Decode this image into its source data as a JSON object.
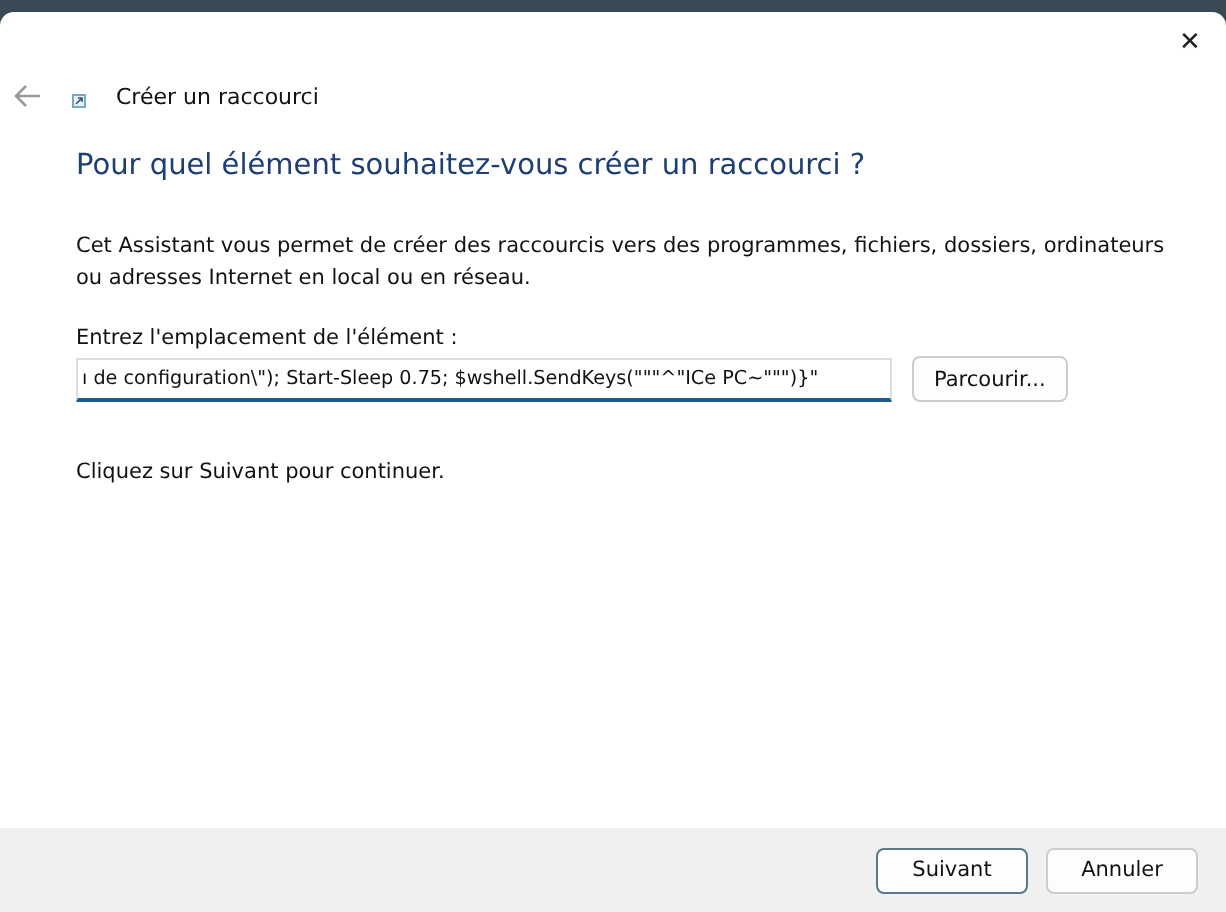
{
  "window": {
    "title": "Créer un raccourci",
    "close": "✕"
  },
  "heading": "Pour quel élément souhaitez-vous créer un raccourci ?",
  "description": "Cet Assistant vous permet de créer des raccourcis vers des programmes, fichiers, dossiers, ordinateurs ou adresses Internet en local ou en réseau.",
  "location": {
    "label": "Entrez l'emplacement de l'élément :",
    "value": "ı de configuration\\\"); Start-Sleep 0.75; $wshell.SendKeys(\"\"\"^\"ICe PC~\"\"\")}\"",
    "browse": "Parcourir..."
  },
  "hint": "Cliquez sur Suivant pour continuer.",
  "buttons": [
    {
      "label": "Suivant",
      "default": true
    },
    {
      "label": "Annuler",
      "default": false
    }
  ]
}
